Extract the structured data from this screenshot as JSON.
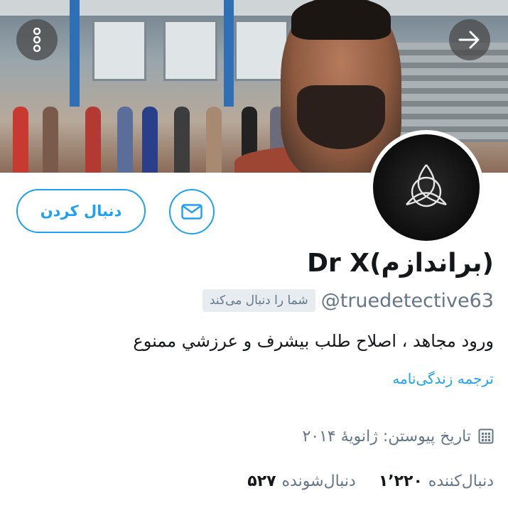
{
  "profile": {
    "name": "Dr X(براندازم)",
    "handle": "@truedetective63",
    "follows_you": "شما را دنبال می‌کند",
    "bio": "ورود مجاهد ، اصلاح طلب بیشرف و عرزشي  ممنوع",
    "translate_bio": "ترجمه زندگی‌نامه",
    "joined": "تاریخ پیوستن: ژانویهٔ ۲۰۱۴",
    "stats": {
      "following_count": "۵۲۷",
      "following_label": "دنبال‌شونده",
      "followers_count": "۱٬۲۲۰",
      "followers_label": "دنبال‌کننده"
    }
  },
  "actions": {
    "follow_label": "دنبال کردن"
  },
  "icons": {
    "more": "more-vertical-icon",
    "next": "arrow-right-icon",
    "message": "envelope-icon",
    "calendar": "calendar-icon",
    "avatar_symbol": "triquetra-icon"
  },
  "colors": {
    "accent": "#1da1f2",
    "secondary_text": "#657786",
    "badge_bg": "#e6ecf0"
  }
}
